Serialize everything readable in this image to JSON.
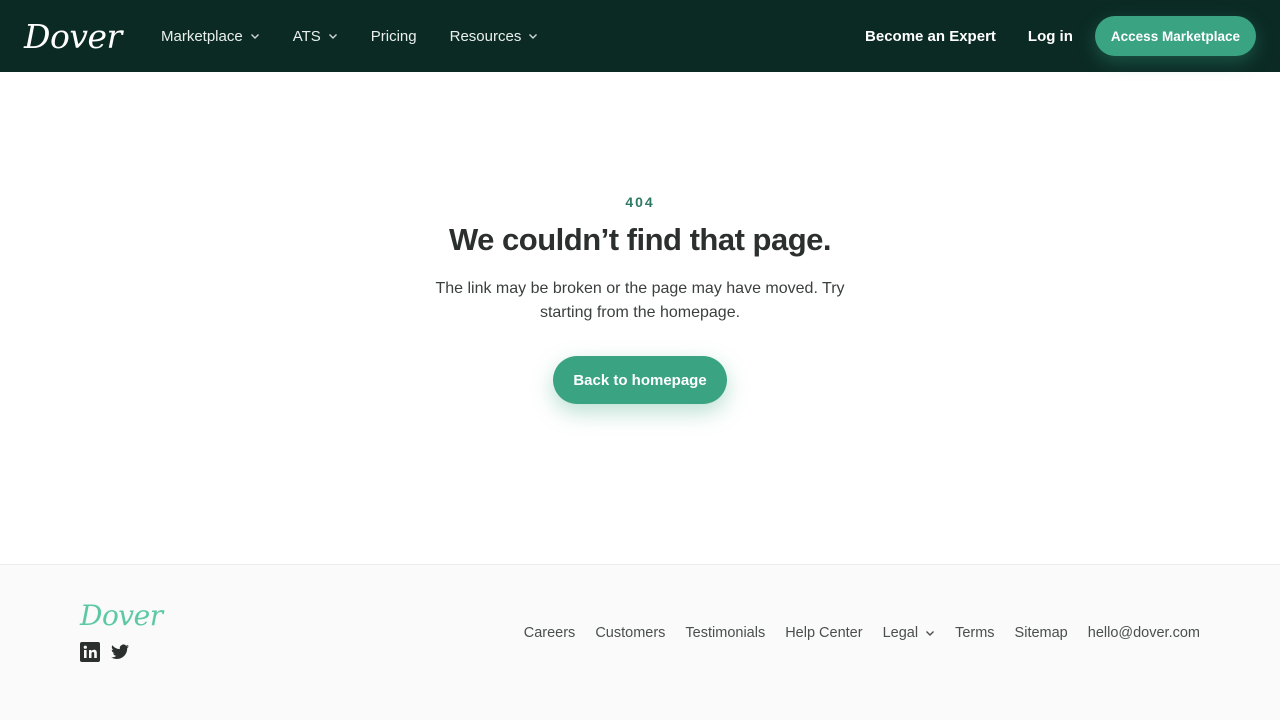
{
  "header": {
    "logo": "Dover",
    "nav": [
      {
        "label": "Marketplace",
        "has_dropdown": true
      },
      {
        "label": "ATS",
        "has_dropdown": true
      },
      {
        "label": "Pricing",
        "has_dropdown": false
      },
      {
        "label": "Resources",
        "has_dropdown": true
      }
    ],
    "become_expert": "Become an Expert",
    "login": "Log in",
    "cta": "Access Marketplace"
  },
  "main": {
    "code": "404",
    "title": "We couldn’t find that page.",
    "description": "The link may be broken or the page may have moved. Try starting from the homepage.",
    "button": "Back to homepage"
  },
  "footer": {
    "logo": "Dover",
    "social": [
      "linkedin-icon",
      "twitter-icon"
    ],
    "links": [
      {
        "label": "Careers",
        "has_dropdown": false
      },
      {
        "label": "Customers",
        "has_dropdown": false
      },
      {
        "label": "Testimonials",
        "has_dropdown": false
      },
      {
        "label": "Help Center",
        "has_dropdown": false
      },
      {
        "label": "Legal",
        "has_dropdown": true
      },
      {
        "label": "Terms",
        "has_dropdown": false
      },
      {
        "label": "Sitemap",
        "has_dropdown": false
      },
      {
        "label": "hello@dover.com",
        "has_dropdown": false
      }
    ]
  },
  "colors": {
    "header_bg": "#0b2a24",
    "accent": "#3aa381",
    "footer_logo": "#5cc9a4"
  }
}
